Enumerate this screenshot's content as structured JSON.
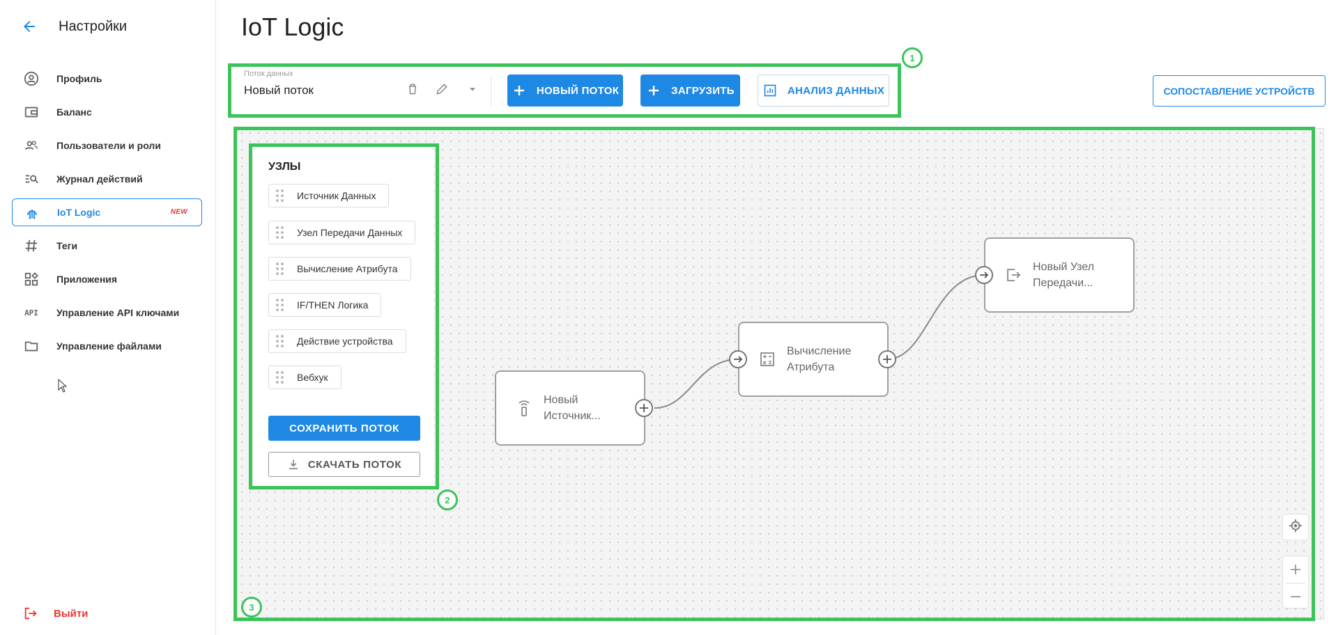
{
  "sidebar": {
    "title": "Настройки",
    "items": [
      {
        "label": "Профиль",
        "icon": "profile-icon"
      },
      {
        "label": "Баланс",
        "icon": "wallet-icon"
      },
      {
        "label": "Пользователи и роли",
        "icon": "users-icon"
      },
      {
        "label": "Журнал действий",
        "icon": "log-search-icon"
      },
      {
        "label": "IoT Logic",
        "icon": "iot-logic-icon",
        "badge": "NEW",
        "active": true
      },
      {
        "label": "Теги",
        "icon": "hash-icon"
      },
      {
        "label": "Приложения",
        "icon": "apps-icon"
      },
      {
        "label": "Управление API ключами",
        "icon": "api-icon",
        "icon_text": "API"
      },
      {
        "label": "Управление файлами",
        "icon": "folder-icon"
      }
    ],
    "logout_label": "Выйти"
  },
  "page": {
    "title": "IoT Logic"
  },
  "toolbar": {
    "flow_label": "Поток данных",
    "flow_value": "Новый поток",
    "new_flow": "НОВЫЙ ПОТОК",
    "upload": "ЗАГРУЗИТЬ",
    "analysis": "АНАЛИЗ ДАННЫХ",
    "device_mapping": "СОПОСТАВЛЕНИЕ УСТРОЙСТВ"
  },
  "palette": {
    "title": "УЗЛЫ",
    "nodes": [
      "Источник Данных",
      "Узел Передачи Данных",
      "Вычисление Атрибута",
      "IF/THEN Логика",
      "Действие устройства",
      "Вебхук"
    ],
    "save": "СОХРАНИТЬ ПОТОК",
    "download": "СКАЧАТЬ ПОТОК"
  },
  "flow": {
    "nodes": [
      {
        "line1": "Новый",
        "line2": "Источник...",
        "icon": "data-source-icon"
      },
      {
        "line1": "Вычисление",
        "line2": "Атрибута",
        "icon": "calculator-icon"
      },
      {
        "line1": "Новый Узел",
        "line2": "Передачи...",
        "icon": "output-icon"
      }
    ]
  },
  "annotations": [
    "1",
    "2",
    "3"
  ],
  "colors": {
    "accent": "#1e88e5",
    "annotation": "#3cc35a",
    "logout": "#e53935",
    "badge": "#e53935"
  }
}
